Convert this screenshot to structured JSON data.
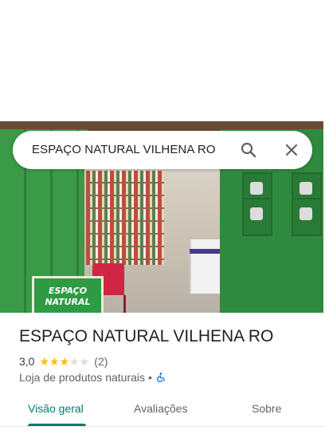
{
  "search": {
    "query": "ESPAÇO NATURAL VILHENA RO"
  },
  "photo": {
    "sign_line1": "ESPAÇO",
    "sign_line2": "NATURAL"
  },
  "place": {
    "title": "ESPAÇO NATURAL VILHENA RO",
    "rating": "3,0",
    "rating_value": 3,
    "rating_max": 5,
    "review_count": "(2)",
    "category": "Loja de produtos naturais",
    "separator": "•",
    "accessibility_icon": "wheelchair-icon"
  },
  "tabs": [
    {
      "label": "Visão geral",
      "active": true
    },
    {
      "label": "Avaliações",
      "active": false
    },
    {
      "label": "Sobre",
      "active": false
    }
  ],
  "colors": {
    "accent": "#00796b",
    "star": "#fbbc04",
    "accessibility": "#1a73e8"
  }
}
